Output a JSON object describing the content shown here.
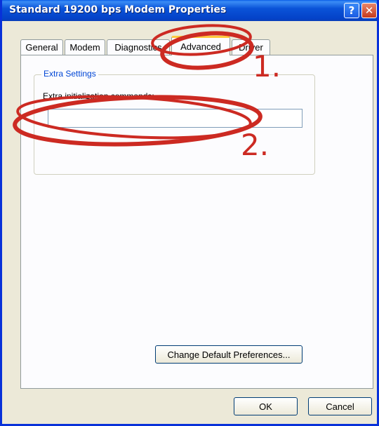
{
  "window": {
    "title": "Standard 19200 bps Modem Properties"
  },
  "titlebar": {
    "help_label": "?",
    "close_label": "✕"
  },
  "tabs": [
    {
      "label": "General"
    },
    {
      "label": "Modem"
    },
    {
      "label": "Diagnostics"
    },
    {
      "label": "Advanced",
      "active": true
    },
    {
      "label": "Driver"
    }
  ],
  "extra_settings": {
    "legend": "Extra Settings",
    "init_label": "Extra initialization commands:",
    "init_value": ""
  },
  "buttons": {
    "change_defaults": "Change Default Preferences...",
    "ok": "OK",
    "cancel": "Cancel"
  },
  "annotations": {
    "step1": "1.",
    "step2": "2.",
    "color": "#cc2a22"
  },
  "colors": {
    "titlebar": "#0a53d8",
    "tab_highlight": "#ffc83c",
    "legend_text": "#0046d5"
  }
}
